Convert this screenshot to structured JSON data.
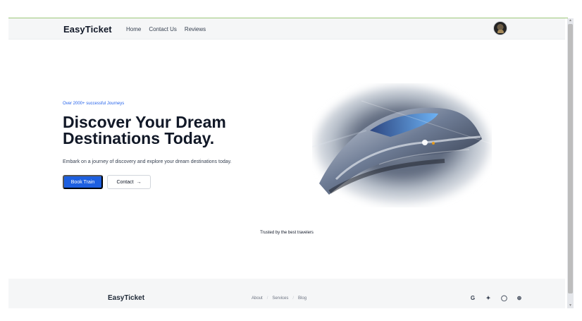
{
  "header": {
    "brand": "EasyTicket",
    "nav": [
      "Home",
      "Contact Us",
      "Reviews"
    ]
  },
  "hero": {
    "eyebrow": "Over 2000+ successful Journeys",
    "title_line_1": "Discover Your Dream",
    "title_line_2": "Destinations Today.",
    "subtitle": "Embark on a journey of discovery and explore your dream destinations today.",
    "primary_button": "Book Train",
    "secondary_button": "Contact",
    "arrow_icon": "→"
  },
  "trusted": "Trusted by the best travelers",
  "footer": {
    "brand": "EasyTicket",
    "links": [
      "About",
      "Services",
      "Blog"
    ],
    "social_icons": [
      "google-icon",
      "twitter-icon",
      "github-icon",
      "web-icon"
    ]
  },
  "colors": {
    "accent": "#1d5fe0",
    "eyebrow": "#2563eb",
    "surface": "#f5f6f7"
  }
}
